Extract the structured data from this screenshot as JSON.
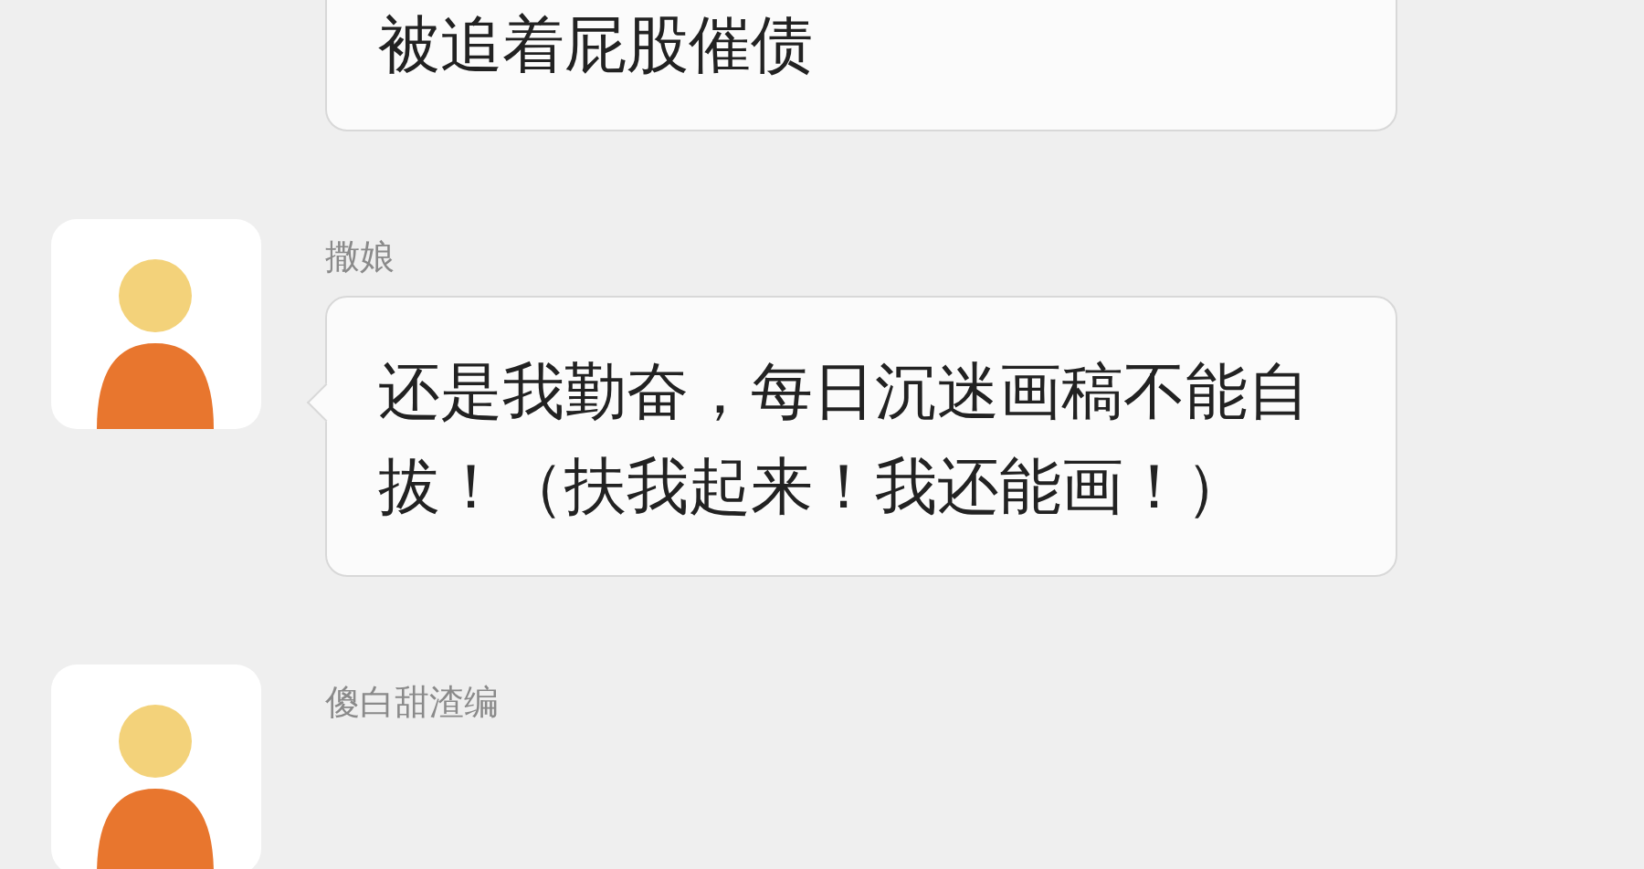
{
  "messages": [
    {
      "text": "被追着屁股催债"
    },
    {
      "sender": "撒娘",
      "text": "还是我勤奋，每日沉迷画稿不能自拔！（扶我起来！我还能画！）"
    },
    {
      "sender": "傻白甜渣编"
    }
  ]
}
